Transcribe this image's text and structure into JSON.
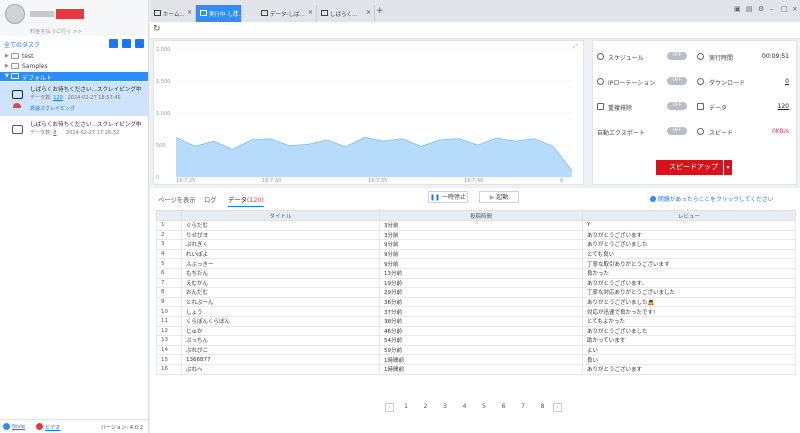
{
  "sidebar": {
    "pay_label": "料金を払うに行く >>",
    "all_tasks": "全てのタスク",
    "folders": [
      {
        "label": "test"
      },
      {
        "label": "Samples"
      },
      {
        "label": "デフォルト"
      }
    ],
    "tasks": [
      {
        "name": "しばらくお待ちください...スクレイピング中",
        "count_label": "データ数:",
        "count": "120",
        "time": "2024-02-27 18:57:45",
        "status": "高速スクレイピング"
      },
      {
        "name": "しばらくお待ちください...スクレイピング中",
        "count_label": "データ数:",
        "count": "8",
        "time": "2024-02-27 17:28:32"
      }
    ],
    "footer": {
      "style": "Stvle",
      "video": "ビデオ",
      "version": "バージョン: 4.0.2"
    }
  },
  "tabs": [
    {
      "label": "ホーム..."
    },
    {
      "label": "実行中-しば..."
    },
    {
      "label": "データ-しば..."
    },
    {
      "label": "しばらく..."
    }
  ],
  "chart_data": {
    "type": "area",
    "x_ticks": [
      "18:7:25",
      "18:7:30",
      "18:7:35",
      "18:7:40",
      "0"
    ],
    "y_ticks": [
      "2,000",
      "1,500",
      "1,000",
      "500",
      "0"
    ],
    "ylim": [
      0,
      2000
    ],
    "values": [
      620,
      480,
      560,
      430,
      580,
      600,
      490,
      510,
      580,
      470,
      620,
      560,
      600,
      480,
      580,
      600,
      500,
      610,
      560,
      600,
      480,
      100
    ]
  },
  "controls": {
    "schedule": "スケジュール",
    "schedule_state": "OFF",
    "ip_rotation": "IPローテーション",
    "ip_state": "OFF",
    "dedup": "重複排除",
    "dedup_state": "OFF",
    "auto_export": "自動エクスポート",
    "auto_state": "OFF",
    "runtime_label": "実行時間",
    "runtime": "00:09:51",
    "download_label": "ダウンロード",
    "download": "0",
    "data_label": "データ",
    "data": "120",
    "speed_label": "スピード",
    "speed": "0KB/s",
    "speedup": "スピードアップ"
  },
  "lower": {
    "tab_page": "ページを表示",
    "tab_log": "ログ",
    "tab_data": "データ",
    "data_count": "(120)",
    "pause": "一時停止",
    "start": "起動",
    "help": "問題があったらここをクリックしてください"
  },
  "table": {
    "headers": [
      "タイトル",
      "投稿時間",
      "レビュー"
    ],
    "rows": [
      [
        "1",
        "ぐらだむ",
        "3分前",
        "Y"
      ],
      [
        "2",
        "りせぴヨ",
        "3分前",
        "ありがとうございます"
      ],
      [
        "3",
        "ぷれぎく",
        "9分前",
        "ありがとうございました"
      ],
      [
        "4",
        "れいぽよ",
        "9分前",
        "とても良い"
      ],
      [
        "5",
        "ふぶっきー",
        "9分前",
        "丁寧な取引ありがとうございます"
      ],
      [
        "6",
        "もちたん",
        "13分前",
        "良かった"
      ],
      [
        "7",
        "えむかん",
        "19分前",
        "ありがとうございます。"
      ],
      [
        "8",
        "おんだむ",
        "29分前",
        "丁寧な対応ありがとうございました"
      ],
      [
        "9",
        "とれぷーん",
        "36分前",
        "ありがとうございました🙇"
      ],
      [
        "10",
        "しょう",
        "37分前",
        "対応が迅速で良かったです!"
      ],
      [
        "11",
        "くらぽんくらぽん",
        "38分前",
        "とてもよかった"
      ],
      [
        "12",
        "じゅか",
        "46分前",
        "ありがとうございました"
      ],
      [
        "13",
        "ぷっちん",
        "54分前",
        "助かっています"
      ],
      [
        "14",
        "ぷれぴこ",
        "59分前",
        "よい"
      ],
      [
        "15",
        "1366877",
        "1時間前",
        "良い"
      ],
      [
        "16",
        "ぷれへ",
        "1時間前",
        "ありがとうございます"
      ]
    ]
  },
  "pagination": [
    "1",
    "2",
    "3",
    "4",
    "5",
    "6",
    "7",
    "8"
  ]
}
